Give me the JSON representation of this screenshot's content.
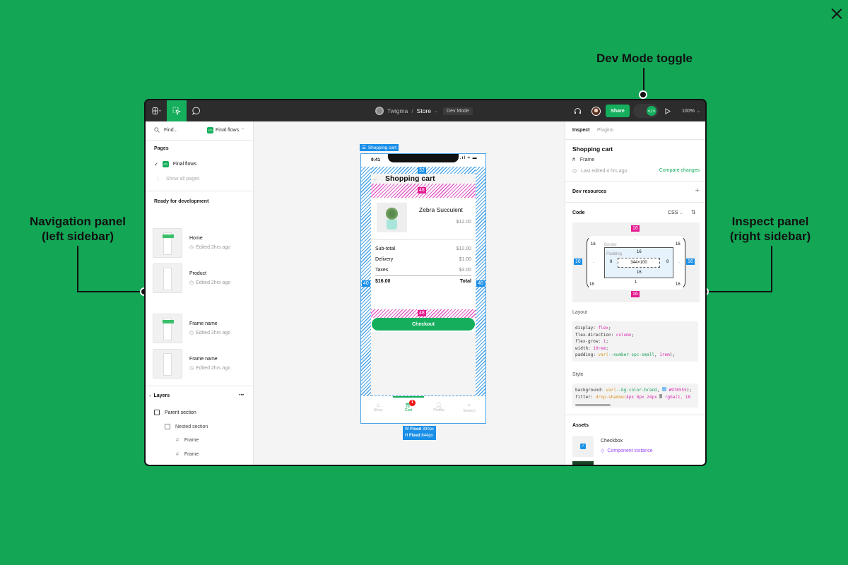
{
  "callouts": {
    "dev_mode": "Dev Mode toggle",
    "nav_panel": [
      "Navigation panel",
      "(left sidebar)"
    ],
    "inspect_panel": [
      "Inspect panel",
      "(right sidebar)"
    ]
  },
  "colors": {
    "background": "#12a655",
    "accent": "#14ae5c",
    "topbar": "#2c2c2c"
  },
  "topbar": {
    "team": "Twigma",
    "separator": "/",
    "file": "Store",
    "mode_badge": "Dev Mode",
    "share": "Share",
    "zoom": "100%"
  },
  "left": {
    "search_placeholder": "Find...",
    "page_selector": "Final flows",
    "pages_heading": "Pages",
    "current_page": "Final flows",
    "show_all": "Show all pages",
    "ready_heading": "Ready for development",
    "frames": [
      {
        "name": "Home",
        "edited": "Edited 2hrs ago"
      },
      {
        "name": "Product",
        "edited": "Edited 2hrs ago"
      },
      {
        "name": "Frame name",
        "edited": "Edited 2hrs ago"
      },
      {
        "name": "Frame name",
        "edited": "Edited 2hrs ago"
      }
    ],
    "layers_heading": "Layers",
    "layers": [
      {
        "name": "Parent section",
        "type": "section"
      },
      {
        "name": "Nested section",
        "type": "section"
      },
      {
        "name": "Frame",
        "type": "frame"
      },
      {
        "name": "Frame",
        "type": "frame"
      }
    ]
  },
  "canvas": {
    "frame_label": "Shopping cart",
    "phone": {
      "time": "9:41",
      "title": "Shopping cart",
      "product": {
        "name": "Zebra Succulent",
        "price": "$12.00"
      },
      "summary": [
        {
          "label": "Sub-total",
          "value": "$12.00"
        },
        {
          "label": "Delivery",
          "value": "$1.00"
        },
        {
          "label": "Taxes",
          "value": "$3.00"
        }
      ],
      "total_value": "$16.00",
      "total_label": "Total",
      "checkout": "Checkout",
      "nav": [
        {
          "label": "Shop",
          "active": false
        },
        {
          "label": "Cart",
          "active": true,
          "badge": "1"
        },
        {
          "label": "Profile",
          "active": false
        },
        {
          "label": "Search",
          "active": false
        }
      ]
    },
    "spacing": {
      "top": "32",
      "gap_a": "48",
      "gap_b": "48",
      "left": "40",
      "right": "40"
    },
    "size": {
      "w_label": "W",
      "w_mode": "Fixed",
      "w_value": "390px",
      "h_label": "H",
      "h_mode": "Fixed",
      "h_value": "844px"
    }
  },
  "right": {
    "tabs": [
      "Inspect",
      "Plugins"
    ],
    "selection_title": "Shopping cart",
    "selection_type": "Frame",
    "last_edited": "Last edited 4 hrs ago",
    "compare": "Compare changes",
    "dev_resources": "Dev resources",
    "code_heading": "Code",
    "code_lang": "CSS",
    "box_model": {
      "margin_top": "16",
      "margin_bottom": "16",
      "margin_left": "16",
      "margin_right": "16",
      "border_label": "Border",
      "border_tl": "16",
      "border_tr": "16",
      "border_bl": "16",
      "border_br": "16",
      "border_top": "-",
      "border_bottom": "1",
      "border_left": "-",
      "border_right": "-",
      "padding_label": "Padding",
      "padding_top": "16",
      "padding_bottom": "16",
      "padding_left": "8",
      "padding_right": "8",
      "content": "344×100"
    },
    "layout_heading": "Layout",
    "layout_code": [
      [
        "display: ",
        "flex",
        ";"
      ],
      [
        "flex-direction: ",
        "column",
        ";"
      ],
      [
        "flex-grow: ",
        "1",
        ";"
      ],
      [
        "width: ",
        "10rem",
        ";"
      ],
      [
        "padding: ",
        "var(--number-spc-small, 1rem)",
        ";"
      ]
    ],
    "style_heading": "Style",
    "style_code": [
      "background: var(--bg-color-brand, #976555);",
      "filter: drop-shadow(4px 8px 24px rgba(1, 18"
    ],
    "assets_heading": "Assets",
    "asset": {
      "name": "Checkbox",
      "kind": "Component instance"
    }
  }
}
